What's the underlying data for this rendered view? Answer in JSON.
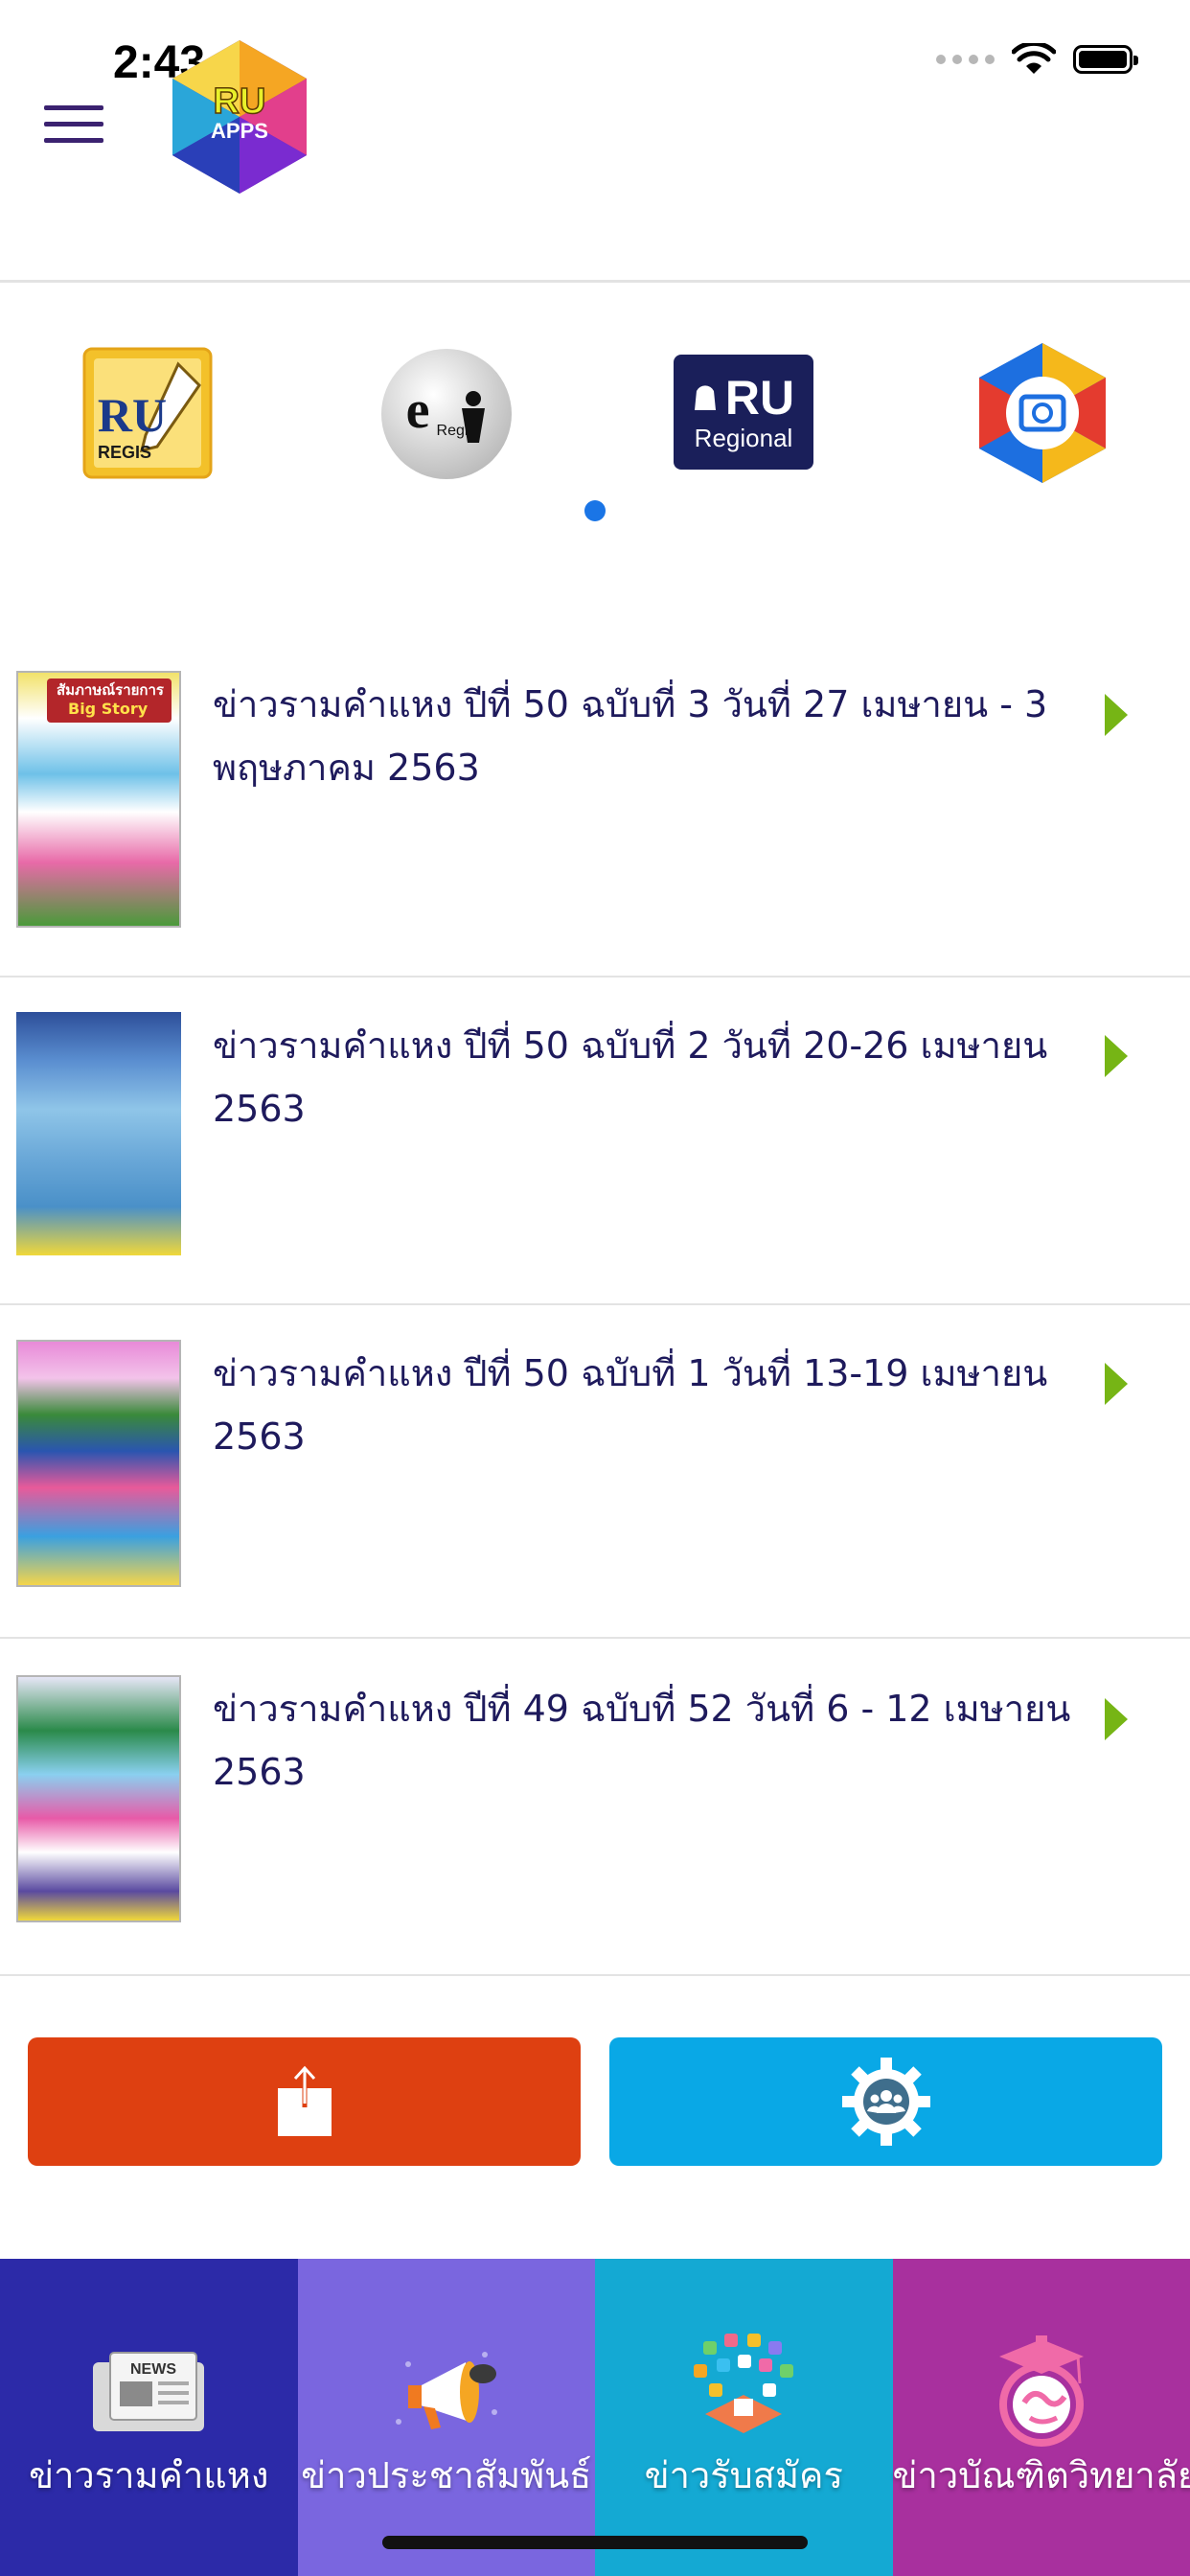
{
  "status_bar": {
    "time": "2:43"
  },
  "header": {
    "logo_line1": "RU",
    "logo_line2": "APPS"
  },
  "carousel": {
    "items": [
      {
        "line1": "RU",
        "line2": "REGIS"
      },
      {
        "line1": "e",
        "line2": "Regis"
      },
      {
        "line1": "RU",
        "line2": "Regional"
      },
      {
        "line1": "",
        "line2": ""
      }
    ],
    "active_page": 1,
    "page_count": 1
  },
  "news": {
    "items": [
      {
        "title": "ข่าวรามคำแหง ปีที่ 50 ฉบับที่ 3 วันที่ 27 เมษายน - 3 พฤษภาคม 2563"
      },
      {
        "title": "ข่าวรามคำแหง ปีที่ 50 ฉบับที่ 2 วันที่ 20-26 เมษายน 2563"
      },
      {
        "title": "ข่าวรามคำแหง ปีที่ 50 ฉบับที่ 1 วันที่ 13-19 เมษายน 2563"
      },
      {
        "title": "ข่าวรามคำแหง ปีที่ 49 ฉบับที่ 52 วันที่ 6 - 12 เมษายน 2563"
      }
    ],
    "thumb_texts": [
      "สัมภาษณ์รายการ",
      "Big Story"
    ]
  },
  "actions": {
    "share_color": "#de4011",
    "group_color": "#09a8e6"
  },
  "bottom_nav": {
    "tabs": [
      {
        "label": "ข่าวรามคำแหง",
        "color": "#2c2aa8",
        "icon_text": "NEWS"
      },
      {
        "label": "ข่าวประชาสัมพันธ์",
        "color": "#7a66df"
      },
      {
        "label": "ข่าวรับสมัคร",
        "color": "#14a9d3"
      },
      {
        "label": "ข่าวบัณฑิตวิทยาลัย",
        "color": "#a8309e"
      }
    ]
  }
}
